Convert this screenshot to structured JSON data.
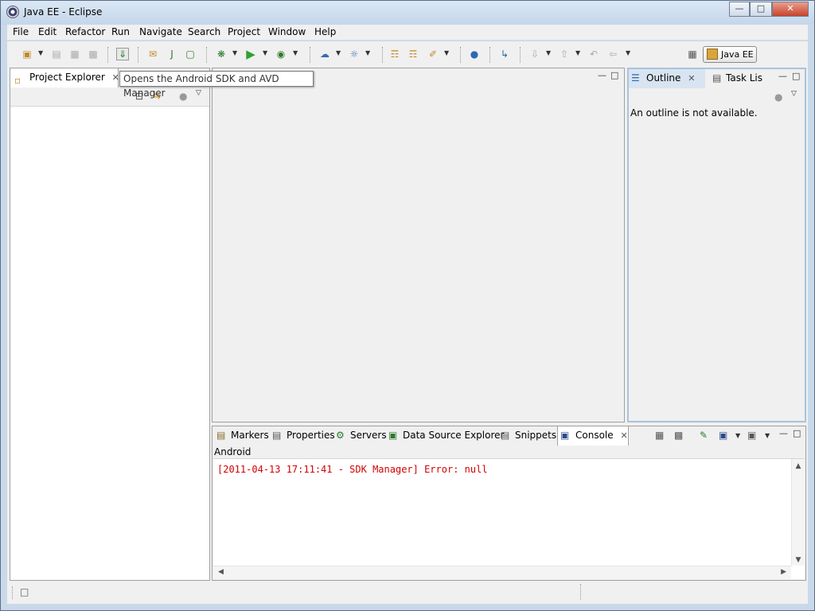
{
  "window": {
    "title": "Java EE - Eclipse",
    "minimize": "—",
    "maximize": "□",
    "close": "✕"
  },
  "menu": [
    "File",
    "Edit",
    "Refactor",
    "Run",
    "Navigate",
    "Search",
    "Project",
    "Window",
    "Help"
  ],
  "toolbar": {
    "perspective_label": "Java EE"
  },
  "tooltip": "Opens the Android SDK and AVD Manager",
  "project_explorer": {
    "tab_label": "Project Explorer"
  },
  "outline": {
    "tab_label": "Outline",
    "task_tab_label": "Task Lis",
    "message": "An outline is not available."
  },
  "bottom_tabs": [
    "Markers",
    "Properties",
    "Servers",
    "Data Source Explorer",
    "Snippets",
    "Console"
  ],
  "console": {
    "name": "Android",
    "lines": [
      "[2011-04-13 17:11:41 - SDK Manager] Error: null"
    ],
    "error_color": "#d20000"
  },
  "colors": {
    "frame": "#c9d9ea",
    "panel_bg": "#f0f0f0"
  }
}
